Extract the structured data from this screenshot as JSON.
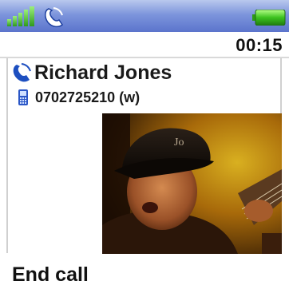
{
  "status_bar": {
    "signal_icon": "signal-strength-icon",
    "call_icon": "call-in-progress-icon",
    "battery_icon": "battery-icon",
    "accent": "#5b74cc"
  },
  "call": {
    "duration": "00:15",
    "caller_name": "Richard Jones",
    "caller_number": "0702725210 (w)",
    "caller_icon": "phone-handset-icon",
    "number_type_icon": "mobile-phone-icon"
  },
  "video": {
    "description_icon": "video-feed"
  },
  "softkeys": {
    "left_label": "End call"
  }
}
